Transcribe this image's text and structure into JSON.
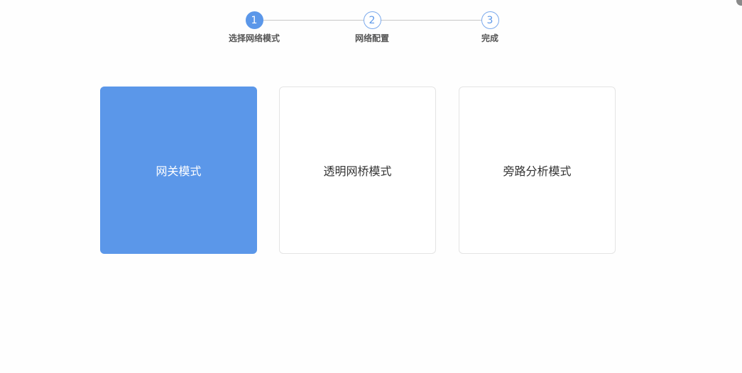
{
  "stepper": {
    "steps": [
      {
        "number": "1",
        "label": "选择网络模式",
        "state": "active"
      },
      {
        "number": "2",
        "label": "网络配置",
        "state": "inactive"
      },
      {
        "number": "3",
        "label": "完成",
        "state": "inactive"
      }
    ]
  },
  "modes": {
    "cards": [
      {
        "label": "网关模式",
        "selected": true
      },
      {
        "label": "透明网桥模式",
        "selected": false
      },
      {
        "label": "旁路分析模式",
        "selected": false
      }
    ]
  },
  "colors": {
    "accent": "#5b97e9",
    "card_border": "#e4e4e4",
    "step_line": "#c8c8c8"
  }
}
